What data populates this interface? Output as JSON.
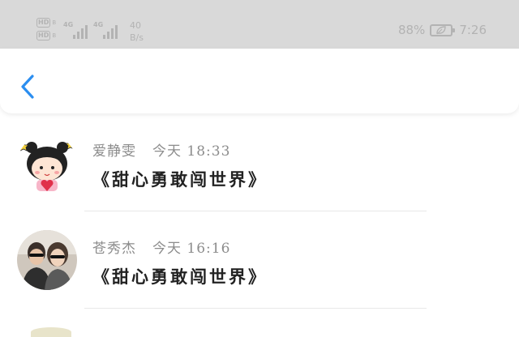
{
  "status_bar": {
    "hd_badge_1": "HD",
    "hd_badge_1_sub": "B",
    "hd_badge_2": "HD",
    "hd_badge_2_sub": "B",
    "network_1": "4G",
    "network_2": "4G",
    "speed_value": "40",
    "speed_unit": "B/s",
    "battery_pct": "88%",
    "time": "7:26"
  },
  "comments": [
    {
      "author": "爱静雯",
      "time": "今天 18:33",
      "text": "《甜心勇敢闯世界》",
      "avatar_icon": "cartoon-girl-avatar"
    },
    {
      "author": "苍秀杰",
      "time": "今天 16:16",
      "text": "《甜心勇敢闯世界》",
      "avatar_icon": "couple-photo-avatar"
    }
  ],
  "colors": {
    "status_bar_bg": "#d9d9d9",
    "accent_blue": "#2b8ef0",
    "meta_gray": "#8c8c8c"
  }
}
